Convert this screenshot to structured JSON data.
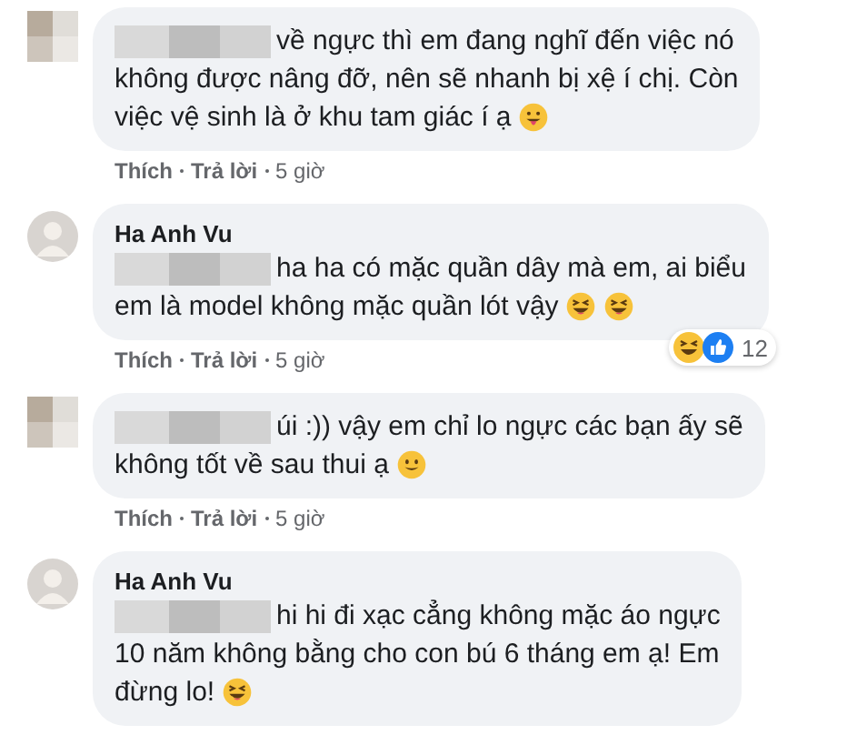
{
  "comments": [
    {
      "avatar": {
        "kind": "blurred"
      },
      "mention_hidden": true,
      "lines": [
        "về ngực thì em đang nghĩ đến việc nó",
        "không được nâng đỡ, nên sẽ nhanh bị xệ í chị. Còn",
        "việc vệ sinh là ở khu tam giác í ạ"
      ],
      "emojis": [
        {
          "kind": "tongue"
        }
      ],
      "actions": [
        "Thích",
        "Trả lời"
      ],
      "time": "5 giờ"
    },
    {
      "avatar": {
        "kind": "photo"
      },
      "author": "Ha Anh Vu",
      "mention_hidden": true,
      "lines": [
        "ha ha có mặc quần dây mà em, ai biểu",
        "em là model không mặc quần lót vậy"
      ],
      "emojis": [
        {
          "kind": "squint"
        },
        {
          "kind": "squint"
        }
      ],
      "actions": [
        "Thích",
        "Trả lời"
      ],
      "time": "5 giờ",
      "reactions": {
        "icons": [
          {
            "kind": "haha"
          },
          {
            "kind": "like"
          }
        ],
        "count": "12"
      }
    },
    {
      "avatar": {
        "kind": "blurred"
      },
      "mention_hidden": true,
      "lines": [
        "úi :)) vậy em chỉ lo ngực các bạn ấy sẽ",
        "không tốt về sau thui ạ"
      ],
      "emojis": [
        {
          "kind": "smile"
        }
      ],
      "actions": [
        "Thích",
        "Trả lời"
      ],
      "time": "5 giờ"
    },
    {
      "avatar": {
        "kind": "photo"
      },
      "author": "Ha Anh Vu",
      "mention_hidden": true,
      "lines": [
        "hi hi đi xạc cẳng không mặc áo ngực",
        "10 năm không bằng cho con bú 6 tháng em ạ! Em",
        "đừng lo!"
      ],
      "emojis": [
        {
          "kind": "squint"
        }
      ]
    }
  ]
}
